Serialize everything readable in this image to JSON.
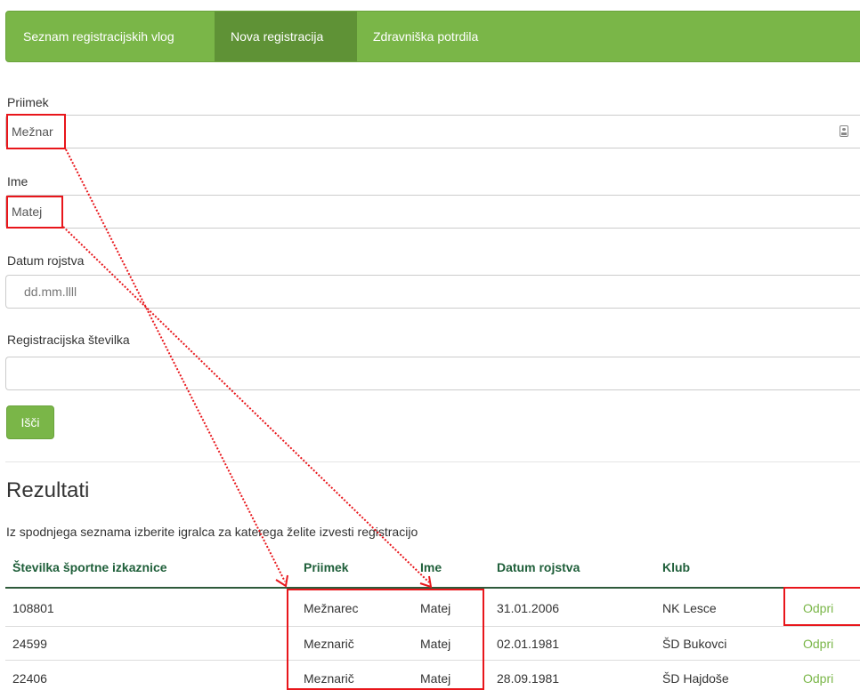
{
  "nav": {
    "items": [
      {
        "label": "Seznam registracijskih vlog"
      },
      {
        "label": "Nova registracija"
      },
      {
        "label": "Zdravniška potrdila"
      }
    ]
  },
  "form": {
    "surname": {
      "label": "Priimek",
      "value": "Mežnar"
    },
    "name": {
      "label": "Ime",
      "value": "Matej"
    },
    "birth": {
      "label": "Datum rojstva",
      "placeholder": "dd.mm.llll"
    },
    "regnum": {
      "label": "Registracijska številka",
      "value": ""
    },
    "search_button": "Išči"
  },
  "results": {
    "title": "Rezultati",
    "subtitle": "Iz spodnjega seznama izberite igralca za katerega želite izvesti registracijo",
    "headers": [
      "Številka športne izkaznice",
      "Priimek",
      "Ime",
      "Datum rojstva",
      "Klub"
    ],
    "rows": [
      {
        "id": "108801",
        "surname": "Mežnarec",
        "name": "Matej",
        "birth": "31.01.2006",
        "club": "NK Lesce",
        "action": "Odpri"
      },
      {
        "id": "24599",
        "surname": "Meznarič",
        "name": "Matej",
        "birth": "02.01.1981",
        "club": "ŠD Bukovci",
        "action": "Odpri"
      },
      {
        "id": "22406",
        "surname": "Meznarič",
        "name": "Matej",
        "birth": "28.09.1981",
        "club": "ŠD Hajdoše",
        "action": "Odpri"
      }
    ]
  },
  "colors": {
    "brand": "#7ab648",
    "brand_active": "#5f9236",
    "annotation": "#e8161b",
    "header_text": "#1f5f3a"
  },
  "icons": {
    "surname_field": "contact-card-icon"
  }
}
